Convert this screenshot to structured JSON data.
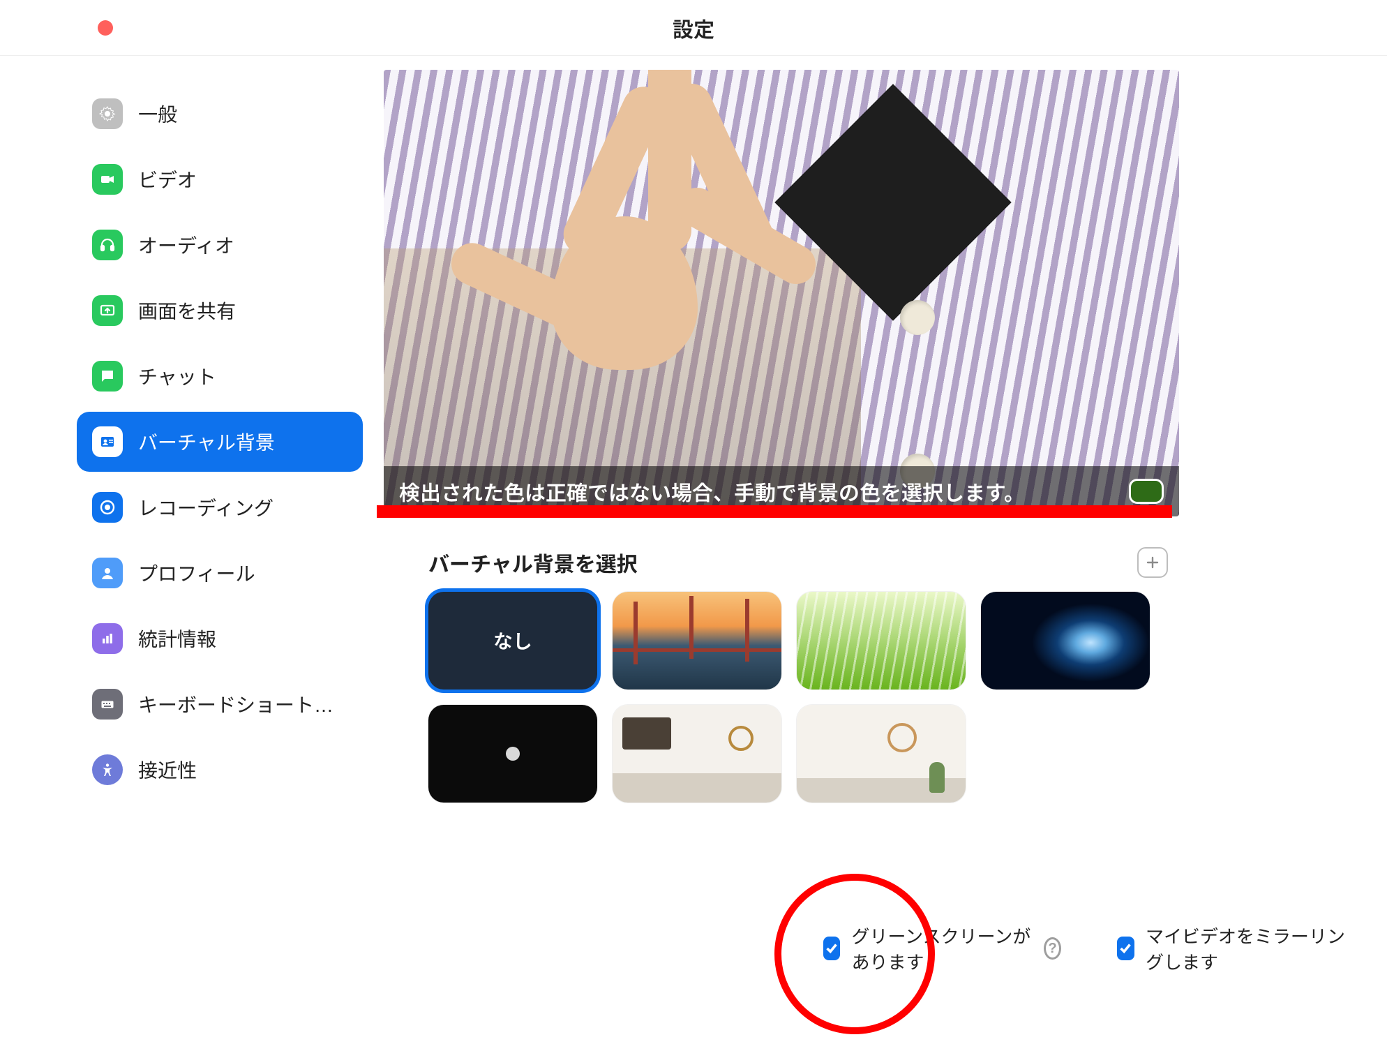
{
  "window": {
    "title": "設定"
  },
  "sidebar": {
    "items": [
      {
        "label": "一般",
        "icon": "gear",
        "color": "#bfbfbf"
      },
      {
        "label": "ビデオ",
        "icon": "video",
        "color": "#29c95e"
      },
      {
        "label": "オーディオ",
        "icon": "headphones",
        "color": "#29c95e"
      },
      {
        "label": "画面を共有",
        "icon": "share",
        "color": "#29c95e"
      },
      {
        "label": "チャット",
        "icon": "chat",
        "color": "#29c95e"
      },
      {
        "label": "バーチャル背景",
        "icon": "contact",
        "color": "#0e72ed",
        "active": true
      },
      {
        "label": "レコーディング",
        "icon": "record",
        "color": "#0e72ed"
      },
      {
        "label": "プロフィール",
        "icon": "user",
        "color": "#4f9cf9"
      },
      {
        "label": "統計情報",
        "icon": "stats",
        "color": "#8e6de9"
      },
      {
        "label": "キーボードショートカ…",
        "icon": "keyboard",
        "color": "#6e6e78"
      },
      {
        "label": "接近性",
        "icon": "accessibility",
        "color": "#6e7bd9"
      }
    ]
  },
  "preview": {
    "overlay_text": "検出された色は正確ではない場合、手動で背景の色を選択します。",
    "picked_color": "#2e6b17"
  },
  "backgrounds": {
    "section_title": "バーチャル背景を選択",
    "none_label": "なし",
    "selected_index": 0
  },
  "options": {
    "green_screen_label": "グリーンスクリーンがあります",
    "mirror_label": "マイビデオをミラーリングします",
    "green_screen_checked": true,
    "mirror_checked": true
  }
}
